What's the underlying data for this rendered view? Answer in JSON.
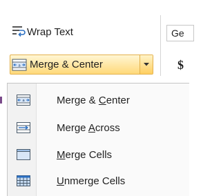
{
  "ribbon": {
    "wrap_text_label": "Wrap Text",
    "merge_center_label": "Merge & Center",
    "font_name_partial": "Ge",
    "currency_symbol": "$"
  },
  "menu": {
    "items": [
      {
        "pre": "Merge & ",
        "accel": "C",
        "post": "enter",
        "icon": "merge-center-icon"
      },
      {
        "pre": "Merge ",
        "accel": "A",
        "post": "cross",
        "icon": "merge-across-icon"
      },
      {
        "pre": "",
        "accel": "M",
        "post": "erge Cells",
        "icon": "merge-cells-icon"
      },
      {
        "pre": "",
        "accel": "U",
        "post": "nmerge Cells",
        "icon": "unmerge-cells-icon"
      }
    ]
  },
  "colors": {
    "highlight_border": "#e3b04b",
    "highlight_fill": "#ffd97a",
    "icon_blue": "#2b6fc2"
  }
}
